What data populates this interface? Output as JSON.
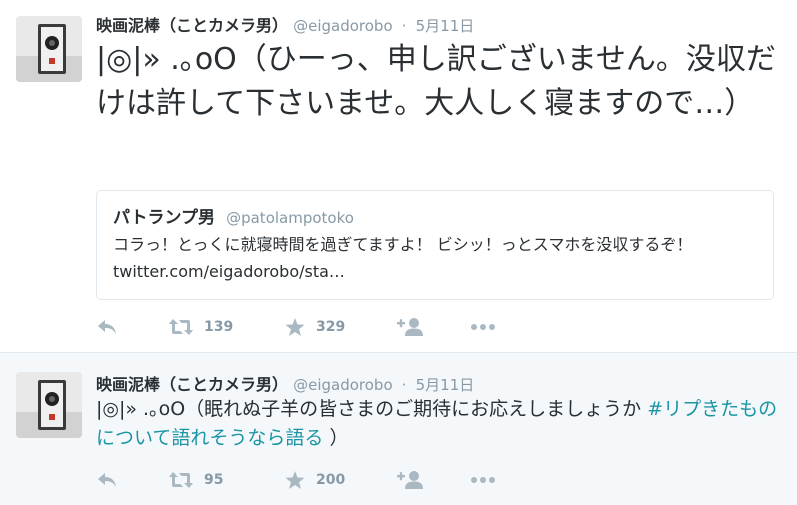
{
  "tweets": [
    {
      "author": {
        "name": "映画泥棒（ことカメラ男）",
        "handle": "@eigadorobo"
      },
      "separator": "·",
      "time": "5月11日",
      "text": "|◎|» .｡oO（ひーっ、申し訳ございません。没収だけは許して下さいませ。大人しく寝ますので…）",
      "quote": {
        "author": {
          "name": "パトランプ男",
          "handle": "@patolampotoko"
        },
        "text": "コラっ！とっくに就寝時間を過ぎてますよ！ ビシッ！っとスマホを没収するぞ！ twitter.com/eigadorobo/sta…"
      },
      "actions": {
        "reply_icon": "reply-icon",
        "retweet_count": "139",
        "like_count": "329",
        "follow_icon": "add-user-icon",
        "more_icon": "more-icon"
      }
    },
    {
      "author": {
        "name": "映画泥棒（ことカメラ男）",
        "handle": "@eigadorobo"
      },
      "separator": "·",
      "time": "5月11日",
      "text_before": "|◎|» .｡oO（眠れぬ子羊の皆さまのご期待にお応えしましょうか ",
      "hashtag": "#リプきたものについて語れそうなら語る",
      "text_after": " ）",
      "actions": {
        "reply_icon": "reply-icon",
        "retweet_count": "95",
        "like_count": "200",
        "follow_icon": "add-user-icon",
        "more_icon": "more-icon"
      }
    }
  ],
  "colors": {
    "text": "#292f33",
    "secondary": "#8899a6",
    "icon": "#aab8c2",
    "hashtag": "#1b95a5",
    "alt_background": "#f5f8fa"
  }
}
